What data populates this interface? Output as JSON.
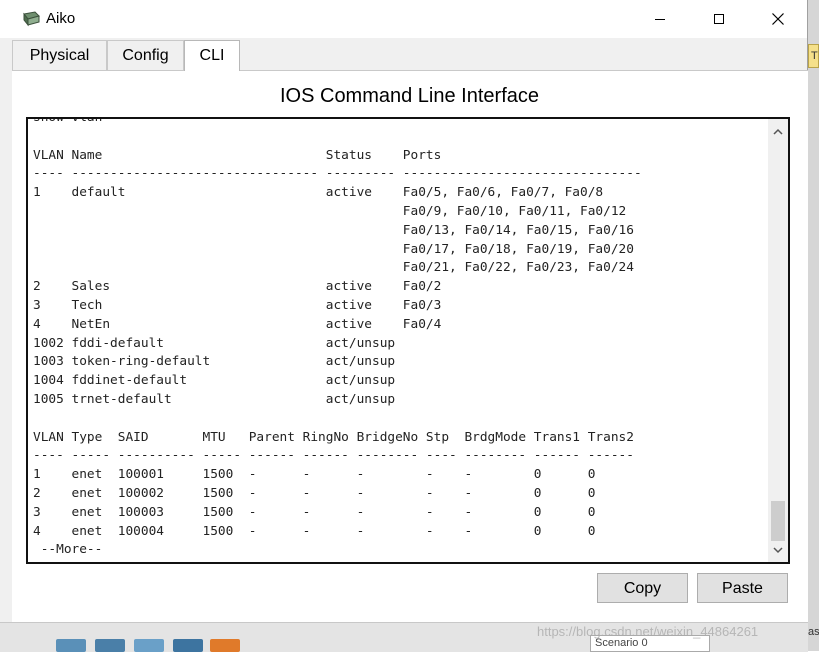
{
  "window": {
    "title": "Aiko",
    "controls": {
      "minimize": "minimize",
      "maximize": "maximize",
      "close": "close"
    }
  },
  "tabs": [
    {
      "label": "Physical",
      "active": false
    },
    {
      "label": "Config",
      "active": false
    },
    {
      "label": "CLI",
      "active": true
    }
  ],
  "cli": {
    "heading": "IOS Command Line Interface",
    "output_lines": [
      "show vlan",
      "",
      "VLAN Name                             Status    Ports",
      "---- -------------------------------- --------- -------------------------------",
      "1    default                          active    Fa0/5, Fa0/6, Fa0/7, Fa0/8",
      "                                                Fa0/9, Fa0/10, Fa0/11, Fa0/12",
      "                                                Fa0/13, Fa0/14, Fa0/15, Fa0/16",
      "                                                Fa0/17, Fa0/18, Fa0/19, Fa0/20",
      "                                                Fa0/21, Fa0/22, Fa0/23, Fa0/24",
      "2    Sales                            active    Fa0/2",
      "3    Tech                             active    Fa0/3",
      "4    NetEn                            active    Fa0/4",
      "1002 fddi-default                     act/unsup",
      "1003 token-ring-default               act/unsup",
      "1004 fddinet-default                  act/unsup",
      "1005 trnet-default                    act/unsup",
      "",
      "VLAN Type  SAID       MTU   Parent RingNo BridgeNo Stp  BrdgMode Trans1 Trans2",
      "---- ----- ---------- ----- ------ ------ -------- ---- -------- ------ ------",
      "1    enet  100001     1500  -      -      -        -    -        0      0",
      "2    enet  100002     1500  -      -      -        -    -        0      0",
      "3    enet  100003     1500  -      -      -        -    -        0      0",
      "4    enet  100004     1500  -      -      -        -    -        0      0",
      " --More--"
    ]
  },
  "buttons": {
    "copy": "Copy",
    "paste": "Paste"
  },
  "background": {
    "scenario_label": "Scenario 0",
    "side_chip": "Ti",
    "side_text": "as",
    "watermark": "https://blog.csdn.net/weixin_44864261"
  },
  "colors": {
    "window_bg": "#f0f0f0",
    "terminal_border": "#111111",
    "button_bg": "#e1e1e1"
  }
}
